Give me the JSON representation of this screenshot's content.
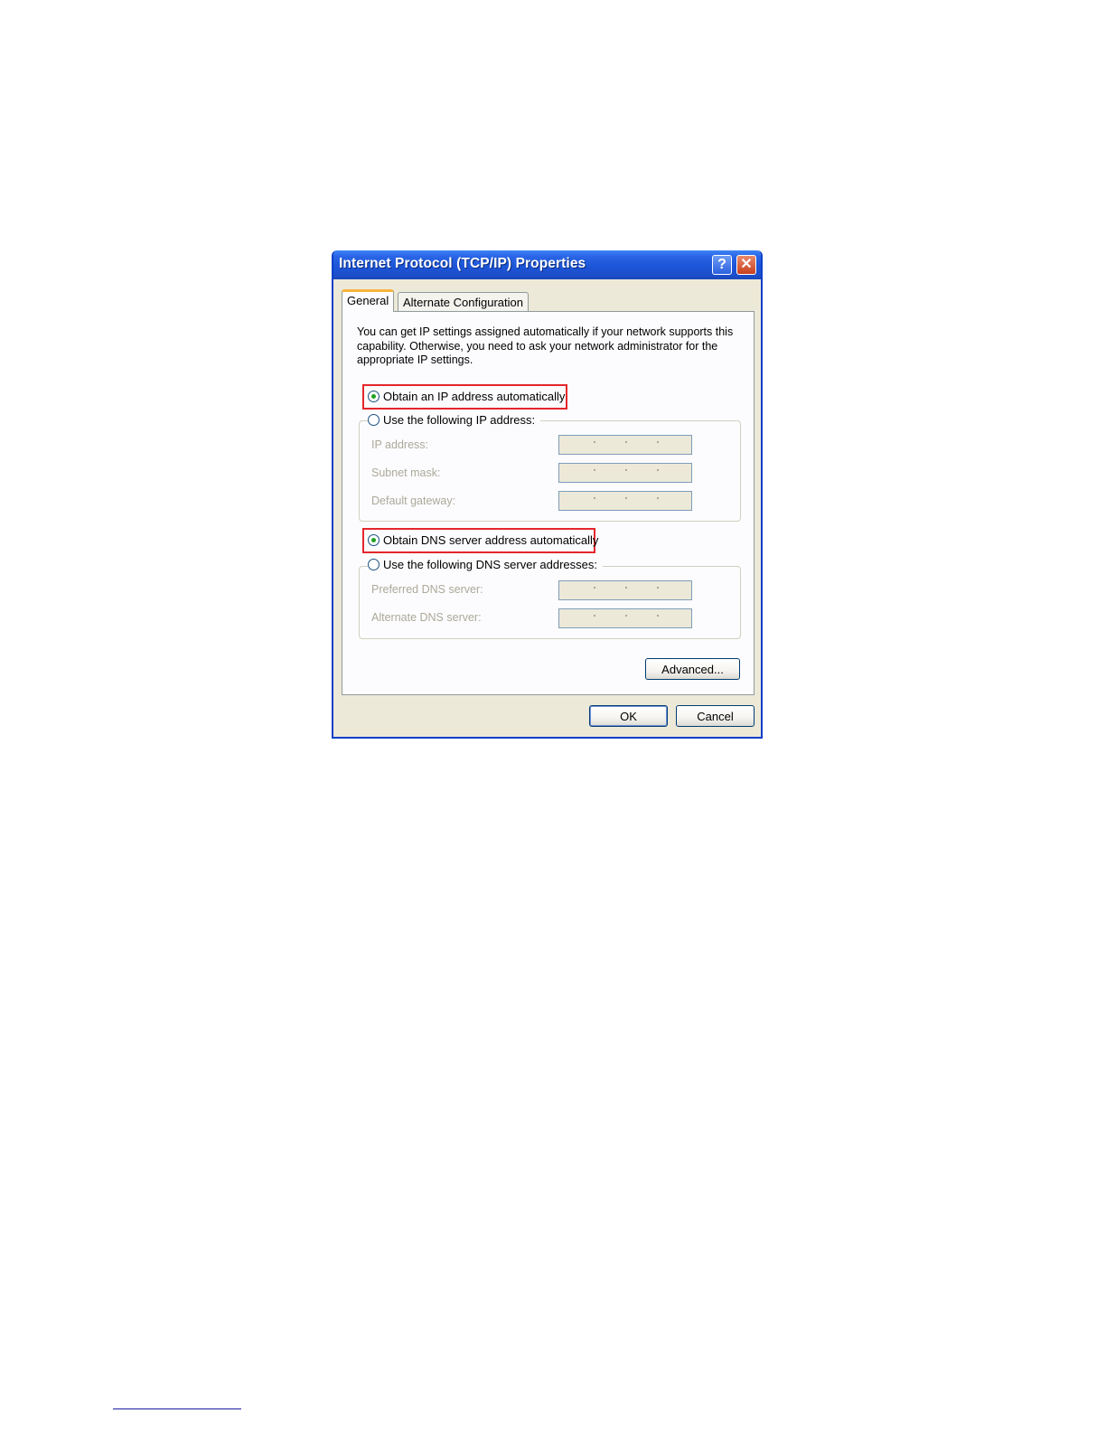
{
  "dialog": {
    "title": "Internet Protocol (TCP/IP) Properties",
    "help_glyph": "?",
    "close_glyph": "✕",
    "tabs": [
      {
        "label": "General",
        "active": true
      },
      {
        "label": "Alternate Configuration",
        "active": false
      }
    ],
    "intro": "You can get IP settings assigned automatically if your network supports this capability. Otherwise, you need to ask your network administrator for the appropriate IP settings.",
    "ip": {
      "auto_label": "Obtain an IP address automatically",
      "manual_label": "Use the following IP address:",
      "selected": "auto",
      "fields": [
        {
          "label": "IP address:"
        },
        {
          "label": "Subnet mask:"
        },
        {
          "label": "Default gateway:"
        }
      ]
    },
    "dns": {
      "auto_label": "Obtain DNS server address automatically",
      "manual_label": "Use the following DNS server addresses:",
      "selected": "auto",
      "fields": [
        {
          "label": "Preferred DNS server:"
        },
        {
          "label": "Alternate DNS server:"
        }
      ]
    },
    "buttons": {
      "advanced": "Advanced...",
      "ok": "OK",
      "cancel": "Cancel"
    },
    "highlight_color": "#e3262b",
    "accent_color": "#1d4fcc"
  }
}
